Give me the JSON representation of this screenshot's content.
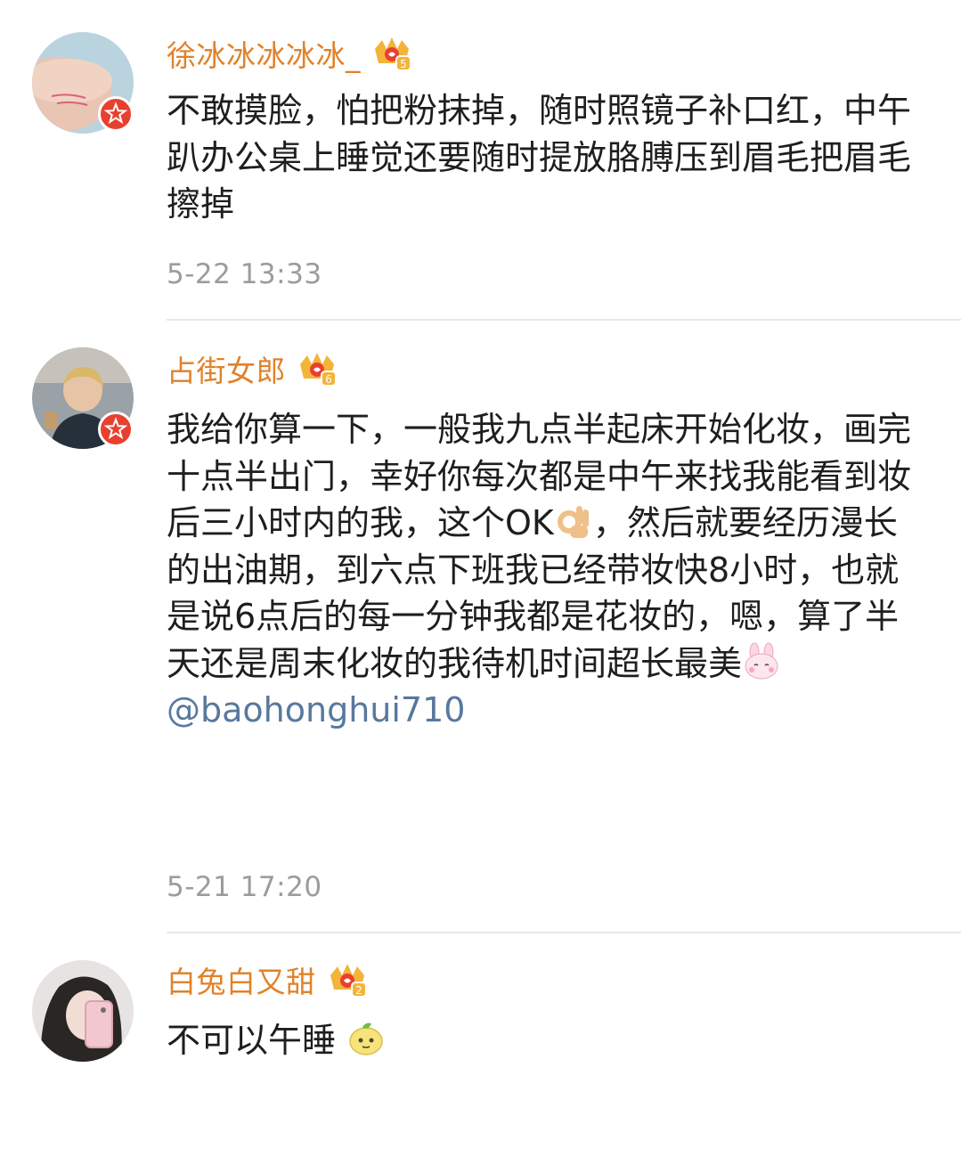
{
  "comments": [
    {
      "username": "徐冰冰冰冰冰_",
      "crown_level": "5",
      "text": "不敢摸脸，怕把粉抹掉，随时照镜子补口红，中午趴办公桌上睡觉还要随时提放胳膊压到眉毛把眉毛擦掉",
      "time": "5-22 13:33"
    },
    {
      "username": "占街女郎",
      "crown_level": "6",
      "text_part1": "我给你算一下，一般我九点半起床开始化妆，画完十点半出门，幸好你每次都是中午来找我能看到妆后三小时内的我，这个OK",
      "text_part2": "，然后就要经历漫长的出油期，到六点下班我已经带妆快8小时，也就是说6点后的每一分钟我都是花妆的，嗯，算了半天还是周末化妆的我待机时间超长最美",
      "mention": "@baohonghui710",
      "time": "5-21 17:20"
    },
    {
      "username": "白兔白又甜",
      "crown_level": "2",
      "text": "不可以午睡",
      "time": ""
    }
  ],
  "icons": {
    "verified_badge": "verified-star-badge-icon",
    "vip_crown": "vip-crown-icon",
    "ok_hand": "ok-hand-emoji-icon",
    "bunny": "bunny-emoji-icon",
    "lemon": "lemon-emoji-icon"
  },
  "colors": {
    "username": "#e0822a",
    "mention": "#58789e",
    "timestamp": "#9c9c9c",
    "badge": "#e8402f",
    "crown": "#f4b43a"
  }
}
